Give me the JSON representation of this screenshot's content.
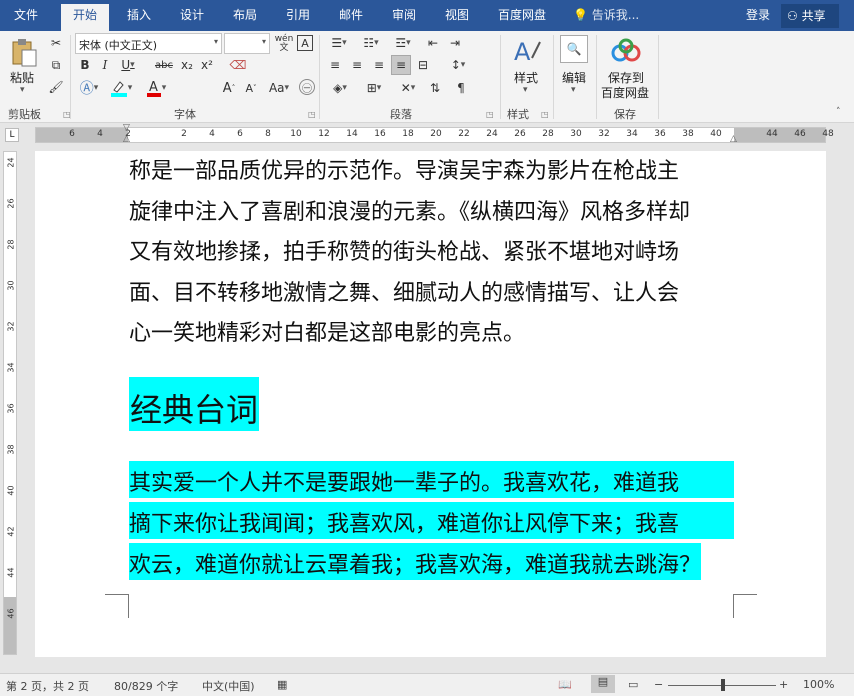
{
  "tabs": [
    {
      "label": "文件",
      "active": false
    },
    {
      "label": "开始",
      "active": true
    },
    {
      "label": "插入",
      "active": false
    },
    {
      "label": "设计",
      "active": false
    },
    {
      "label": "布局",
      "active": false
    },
    {
      "label": "引用",
      "active": false
    },
    {
      "label": "邮件",
      "active": false
    },
    {
      "label": "审阅",
      "active": false
    },
    {
      "label": "视图",
      "active": false
    },
    {
      "label": "百度网盘",
      "active": false
    }
  ],
  "tell_me": "告诉我...",
  "login": "登录",
  "share": "共享",
  "ribbon": {
    "clipboard": {
      "paste": "粘贴",
      "group": "剪贴板"
    },
    "font": {
      "name": "宋体 (中文正文)",
      "size": "",
      "group": "字体",
      "wen": "wén",
      "wen_char": "文",
      "A_box": "A",
      "bold": "B",
      "italic": "I",
      "underline": "U",
      "strike": "abc",
      "sub": "x₂",
      "sup": "x²",
      "grow": "A",
      "shrink": "A",
      "aa": "Aa"
    },
    "paragraph": {
      "group": "段落"
    },
    "styles": {
      "label": "样式",
      "group": "样式"
    },
    "editing": {
      "label": "编辑"
    },
    "save": {
      "line1": "保存到",
      "line2": "百度网盘",
      "group": "保存"
    }
  },
  "hruler_ticks": [
    "6",
    "4",
    "2",
    "",
    "2",
    "4",
    "6",
    "8",
    "10",
    "12",
    "14",
    "16",
    "18",
    "20",
    "22",
    "24",
    "26",
    "28",
    "30",
    "32",
    "34",
    "36",
    "38",
    "40",
    "",
    "44",
    "46",
    "48"
  ],
  "vruler_ticks": [
    "24",
    "26",
    "28",
    "30",
    "32",
    "34",
    "36",
    "38",
    "40",
    "42",
    "44",
    "46"
  ],
  "tab_selector": "L",
  "document": {
    "lines": [
      "称是一部品质优异的示范作。导演吴宇森为影片在枪战主",
      "旋律中注入了喜剧和浪漫的元素。《纵横四海》风格多样却",
      "又有效地掺揉，拍手称赞的街头枪战、紧张不堪地对峙场",
      "面、目不转移地激情之舞、细腻动人的感情描写、让人会",
      "心一笑地精彩对白都是这部电影的亮点。"
    ],
    "heading": "经典台词",
    "quote_lines": [
      "其实爱一个人并不是要跟她一辈子的。我喜欢花，难道我",
      "摘下来你让我闻闻；我喜欢风，难道你让风停下来；我喜",
      "欢云，难道你就让云罩着我；我喜欢海，难道我就去跳海？"
    ]
  },
  "status": {
    "page": "第 2 页，共 2 页",
    "words": "80/829 个字",
    "lang": "中文(中国)",
    "zoom": "100%"
  },
  "colors": {
    "accent": "#2b579a",
    "highlight": "#00ffff"
  }
}
